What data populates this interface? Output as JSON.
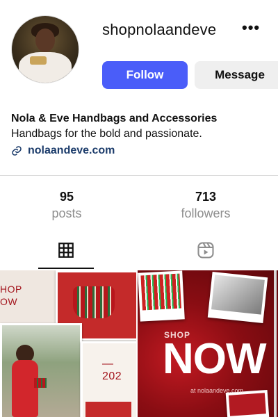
{
  "profile": {
    "username": "shopnolaandeve",
    "follow_label": "Follow",
    "message_label": "Message",
    "display_name": "Nola & Eve Handbags and Accessories",
    "tagline": "Handbags for the bold and passionate.",
    "website": "nolaandeve.com"
  },
  "stats": {
    "posts_count": "95",
    "posts_label": "posts",
    "followers_count": "713",
    "followers_label": "followers"
  },
  "tabs": [
    {
      "icon": "grid-icon",
      "active": true
    },
    {
      "icon": "reels-icon",
      "active": false
    }
  ],
  "posts": [
    {
      "shop_text": "HOP\nOW",
      "year_text": "— 202"
    },
    {
      "shop_text": "SHOP",
      "now_text": "NOW",
      "site_text": "at nolaandeve.com"
    }
  ],
  "colors": {
    "follow_button": "#4a5df9",
    "message_button": "#efefef",
    "link": "#1c3c6b",
    "brand_red": "#a3141c"
  }
}
